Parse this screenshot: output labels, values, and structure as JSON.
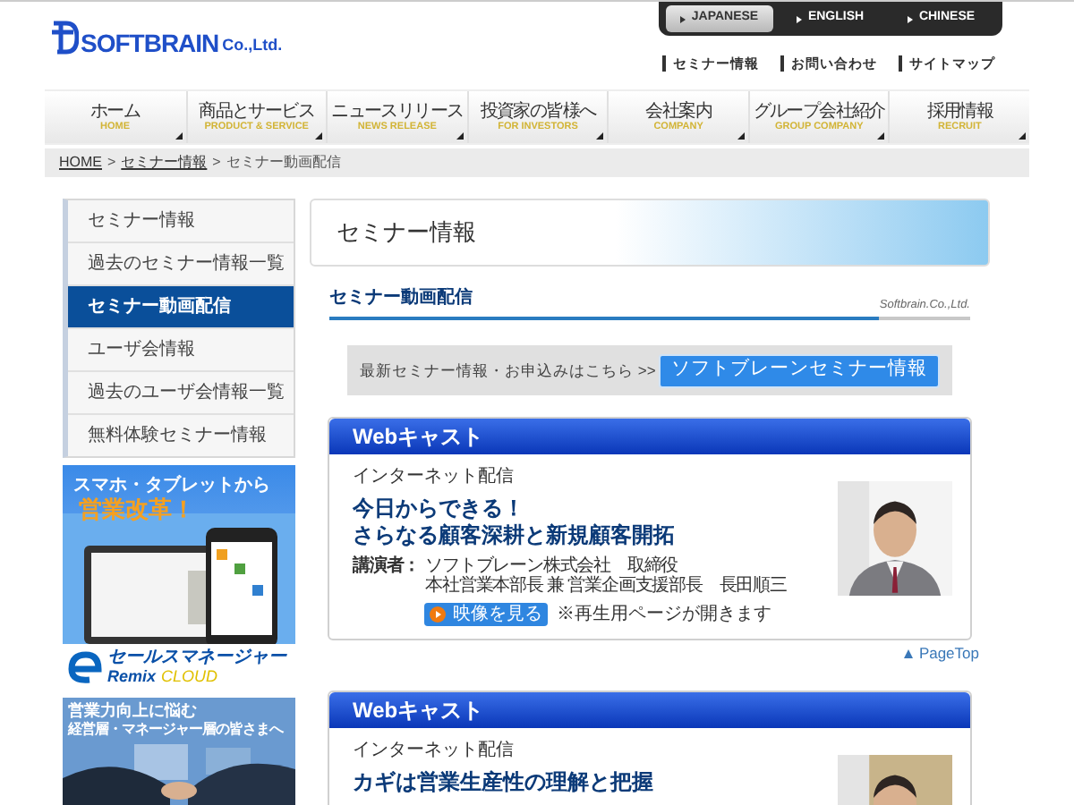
{
  "logo": {
    "brand": "SOFTBRAIN",
    "suffix": "Co.,Ltd."
  },
  "languages": [
    {
      "label": "JAPANESE",
      "selected": true
    },
    {
      "label": "ENGLISH",
      "selected": false
    },
    {
      "label": "CHINESE",
      "selected": false
    }
  ],
  "utility_links": [
    "セミナー情報",
    "お問い合わせ",
    "サイトマップ"
  ],
  "nav": [
    {
      "label": "ホーム",
      "sub": "HOME"
    },
    {
      "label": "商品とサービス",
      "sub": "PRODUCT & SERVICE"
    },
    {
      "label": "ニュースリリース",
      "sub": "NEWS RELEASE"
    },
    {
      "label": "投資家の皆様へ",
      "sub": "FOR INVESTORS"
    },
    {
      "label": "会社案内",
      "sub": "COMPANY"
    },
    {
      "label": "グループ会社紹介",
      "sub": "GROUP COMPANY"
    },
    {
      "label": "採用情報",
      "sub": "RECRUIT"
    }
  ],
  "breadcrumb": {
    "links": [
      "HOME",
      "セミナー情報"
    ],
    "separator": ">",
    "current": "セミナー動画配信"
  },
  "sidebar": {
    "items": [
      {
        "label": "セミナー情報",
        "selected": false
      },
      {
        "label": "過去のセミナー情報一覧",
        "selected": false
      },
      {
        "label": "セミナー動画配信",
        "selected": true
      },
      {
        "label": "ユーザ会情報",
        "selected": false
      },
      {
        "label": "過去のユーザ会情報一覧",
        "selected": false
      },
      {
        "label": "無料体験セミナー情報",
        "selected": false
      }
    ],
    "banners": [
      {
        "headline": "スマホ・タブレットから",
        "catch": "営業改革！",
        "product": "セールスマネージャー",
        "product_sub": "Remix",
        "product_tag": "CLOUD"
      },
      {
        "headline": "営業力向上に悩む",
        "catch": "経営層・マネージャー層の皆さまへ"
      }
    ]
  },
  "page_title": "セミナー情報",
  "section": {
    "title": "セミナー動画配信",
    "company": "Softbrain.Co.,Ltd."
  },
  "promo": {
    "text": "最新セミナー情報・お申込みはこちら >>",
    "button": "ソフトブレーンセミナー情報"
  },
  "webcasts": [
    {
      "header": "Webキャスト",
      "category": "インターネット配信",
      "title_lines": [
        "今日からできる！",
        "さらなる顧客深耕と新規顧客開拓"
      ],
      "speaker_label": "講演者：",
      "speaker_lines": [
        "ソフトブレーン株式会社　取締役",
        "本社営業本部長 兼 営業企画支援部長　長田順三"
      ],
      "watch_button": "映像を見る",
      "note": "※再生用ページが開きます",
      "page_top": "PageTop"
    },
    {
      "header": "Webキャスト",
      "category": "インターネット配信",
      "title_lines": [
        "カギは営業生産性の理解と把握"
      ]
    }
  ]
}
